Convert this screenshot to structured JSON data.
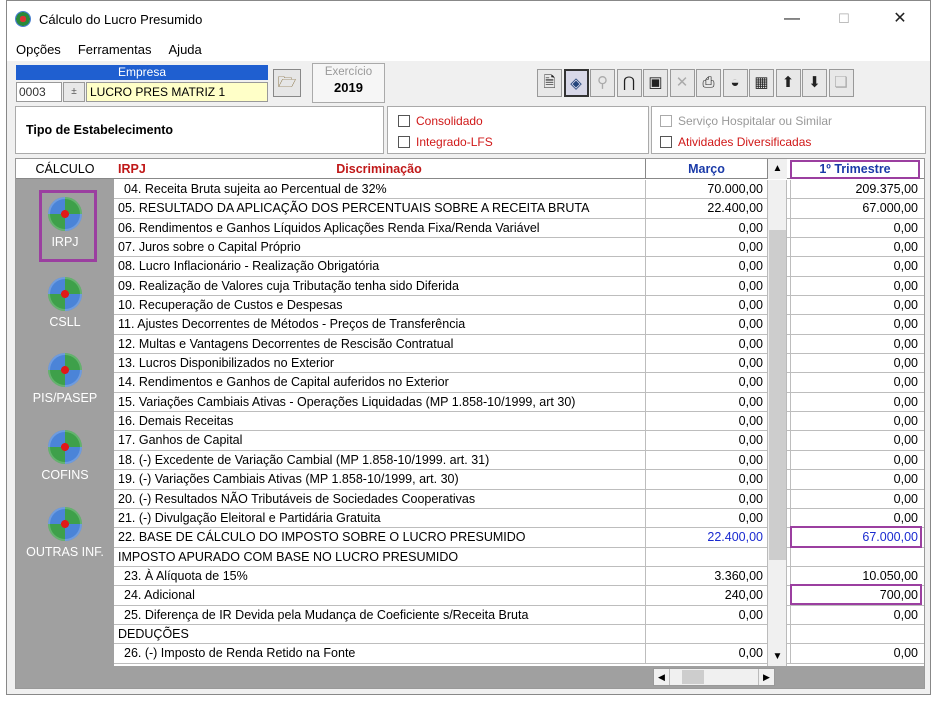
{
  "window": {
    "title": "Cálculo do Lucro Presumido",
    "minimize": "—",
    "maximize": "☐",
    "close": "✕"
  },
  "menu": [
    "Opções",
    "Ferramentas",
    "Ajuda"
  ],
  "empresa": {
    "label": "Empresa",
    "code": "0003",
    "spin": "±",
    "name": "LUCRO  PRES MATRIZ 1"
  },
  "exercicio": {
    "label": "Exercício",
    "value": "2019"
  },
  "toolbar": [
    {
      "icon": "document-icon",
      "glyph": "🗎"
    },
    {
      "icon": "calculate-icon",
      "glyph": "◈"
    },
    {
      "icon": "zoom-icon",
      "glyph": "⚲"
    },
    {
      "icon": "lock-icon",
      "glyph": "⋂"
    },
    {
      "icon": "save-icon",
      "glyph": "▣"
    },
    {
      "icon": "delete-icon",
      "glyph": "✕"
    },
    {
      "icon": "print-icon",
      "glyph": "⎙"
    },
    {
      "icon": "globe-icon",
      "glyph": "◒"
    },
    {
      "icon": "report-icon",
      "glyph": "▦"
    },
    {
      "icon": "export-icon",
      "glyph": "⬆"
    },
    {
      "icon": "import-icon",
      "glyph": "⬇"
    },
    {
      "icon": "layers-icon",
      "glyph": "❏"
    }
  ],
  "tipo": {
    "label": "Tipo de Estabelecimento",
    "consolidado": "Consolidado",
    "integrado": "Integrado-LFS",
    "servico": "Serviço Hospitalar ou Similar",
    "atividades": "Atividades Diversificadas"
  },
  "calculo": {
    "header": "CÁLCULO",
    "items": [
      "IRPJ",
      "CSLL",
      "PIS/PASEP",
      "COFINS",
      "OUTRAS INF."
    ]
  },
  "grid": {
    "irpj": "IRPJ",
    "discriminacao": "Discriminação",
    "marco": "Março",
    "trimestre": "1º Trimestre",
    "rows": [
      {
        "desc": "04. Receita Bruta sujeita ao Percentual de 32%",
        "v1": "70.000,00",
        "v2": "209.375,00",
        "indent": true
      },
      {
        "desc": "05. RESULTADO DA APLICAÇÃO DOS PERCENTUAIS SOBRE A RECEITA BRUTA",
        "v1": "22.400,00",
        "v2": "67.000,00"
      },
      {
        "desc": "06. Rendimentos e Ganhos Líquidos Aplicações Renda Fixa/Renda Variável",
        "v1": "0,00",
        "v2": "0,00"
      },
      {
        "desc": "07. Juros sobre o Capital Próprio",
        "v1": "0,00",
        "v2": "0,00"
      },
      {
        "desc": "08. Lucro Inflacionário - Realização Obrigatória",
        "v1": "0,00",
        "v2": "0,00"
      },
      {
        "desc": "09. Realização de Valores cuja Tributação tenha sido Diferida",
        "v1": "0,00",
        "v2": "0,00"
      },
      {
        "desc": "10. Recuperação de Custos e Despesas",
        "v1": "0,00",
        "v2": "0,00"
      },
      {
        "desc": "11. Ajustes Decorrentes de Métodos - Preços de Transferência",
        "v1": "0,00",
        "v2": "0,00"
      },
      {
        "desc": "12. Multas e Vantagens Decorrentes de Rescisão Contratual",
        "v1": "0,00",
        "v2": "0,00"
      },
      {
        "desc": "13. Lucros Disponibilizados no Exterior",
        "v1": "0,00",
        "v2": "0,00"
      },
      {
        "desc": "14. Rendimentos e Ganhos de Capital auferidos no Exterior",
        "v1": "0,00",
        "v2": "0,00"
      },
      {
        "desc": "15. Variações Cambiais Ativas - Operações Liquidadas (MP 1.858-10/1999, art 30)",
        "v1": "0,00",
        "v2": "0,00"
      },
      {
        "desc": "16. Demais Receitas",
        "v1": "0,00",
        "v2": "0,00"
      },
      {
        "desc": "17. Ganhos de Capital",
        "v1": "0,00",
        "v2": "0,00"
      },
      {
        "desc": "18. (-) Excedente de Variação Cambial (MP 1.858-10/1999. art. 31)",
        "v1": "0,00",
        "v2": "0,00"
      },
      {
        "desc": "19. (-) Variações Cambiais Ativas (MP 1.858-10/1999, art. 30)",
        "v1": "0,00",
        "v2": "0,00"
      },
      {
        "desc": "20. (-) Resultados NÃO Tributáveis de Sociedades Cooperativas",
        "v1": "0,00",
        "v2": "0,00"
      },
      {
        "desc": "21. (-) Divulgação Eleitoral e Partidária Gratuita",
        "v1": "0,00",
        "v2": "0,00"
      },
      {
        "desc": "22. BASE DE CÁLCULO DO IMPOSTO SOBRE O LUCRO PRESUMIDO",
        "v1": "22.400,00",
        "v2": "67.000,00",
        "blue": true
      },
      {
        "desc": "IMPOSTO APURADO COM BASE NO LUCRO PRESUMIDO",
        "v1": "",
        "v2": ""
      },
      {
        "desc": "23. À Alíquota de 15%",
        "v1": "3.360,00",
        "v2": "10.050,00",
        "indent": true
      },
      {
        "desc": "24. Adicional",
        "v1": "240,00",
        "v2": "700,00",
        "indent": true
      },
      {
        "desc": "25. Diferença de IR Devida pela Mudança de Coeficiente s/Receita Bruta",
        "v1": "0,00",
        "v2": "0,00",
        "indent": true
      },
      {
        "desc": "DEDUÇÕES",
        "v1": "",
        "v2": ""
      },
      {
        "desc": "26. (-) Imposto de Renda Retido na Fonte",
        "v1": "0,00",
        "v2": "0,00",
        "indent": true
      }
    ]
  }
}
